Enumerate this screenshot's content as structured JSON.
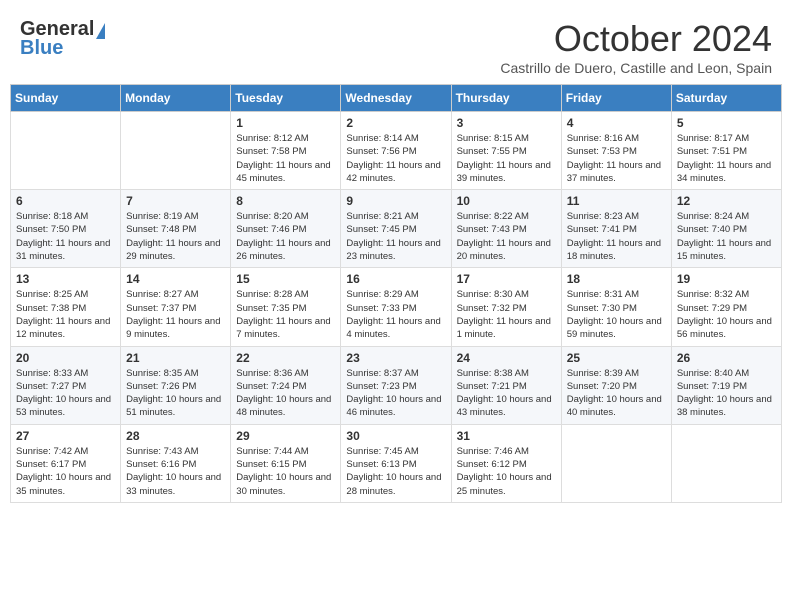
{
  "header": {
    "logo_general": "General",
    "logo_blue": "Blue",
    "month_title": "October 2024",
    "subtitle": "Castrillo de Duero, Castille and Leon, Spain"
  },
  "days_of_week": [
    "Sunday",
    "Monday",
    "Tuesday",
    "Wednesday",
    "Thursday",
    "Friday",
    "Saturday"
  ],
  "weeks": [
    [
      {
        "day": "",
        "content": ""
      },
      {
        "day": "",
        "content": ""
      },
      {
        "day": "1",
        "content": "Sunrise: 8:12 AM\nSunset: 7:58 PM\nDaylight: 11 hours and 45 minutes."
      },
      {
        "day": "2",
        "content": "Sunrise: 8:14 AM\nSunset: 7:56 PM\nDaylight: 11 hours and 42 minutes."
      },
      {
        "day": "3",
        "content": "Sunrise: 8:15 AM\nSunset: 7:55 PM\nDaylight: 11 hours and 39 minutes."
      },
      {
        "day": "4",
        "content": "Sunrise: 8:16 AM\nSunset: 7:53 PM\nDaylight: 11 hours and 37 minutes."
      },
      {
        "day": "5",
        "content": "Sunrise: 8:17 AM\nSunset: 7:51 PM\nDaylight: 11 hours and 34 minutes."
      }
    ],
    [
      {
        "day": "6",
        "content": "Sunrise: 8:18 AM\nSunset: 7:50 PM\nDaylight: 11 hours and 31 minutes."
      },
      {
        "day": "7",
        "content": "Sunrise: 8:19 AM\nSunset: 7:48 PM\nDaylight: 11 hours and 29 minutes."
      },
      {
        "day": "8",
        "content": "Sunrise: 8:20 AM\nSunset: 7:46 PM\nDaylight: 11 hours and 26 minutes."
      },
      {
        "day": "9",
        "content": "Sunrise: 8:21 AM\nSunset: 7:45 PM\nDaylight: 11 hours and 23 minutes."
      },
      {
        "day": "10",
        "content": "Sunrise: 8:22 AM\nSunset: 7:43 PM\nDaylight: 11 hours and 20 minutes."
      },
      {
        "day": "11",
        "content": "Sunrise: 8:23 AM\nSunset: 7:41 PM\nDaylight: 11 hours and 18 minutes."
      },
      {
        "day": "12",
        "content": "Sunrise: 8:24 AM\nSunset: 7:40 PM\nDaylight: 11 hours and 15 minutes."
      }
    ],
    [
      {
        "day": "13",
        "content": "Sunrise: 8:25 AM\nSunset: 7:38 PM\nDaylight: 11 hours and 12 minutes."
      },
      {
        "day": "14",
        "content": "Sunrise: 8:27 AM\nSunset: 7:37 PM\nDaylight: 11 hours and 9 minutes."
      },
      {
        "day": "15",
        "content": "Sunrise: 8:28 AM\nSunset: 7:35 PM\nDaylight: 11 hours and 7 minutes."
      },
      {
        "day": "16",
        "content": "Sunrise: 8:29 AM\nSunset: 7:33 PM\nDaylight: 11 hours and 4 minutes."
      },
      {
        "day": "17",
        "content": "Sunrise: 8:30 AM\nSunset: 7:32 PM\nDaylight: 11 hours and 1 minute."
      },
      {
        "day": "18",
        "content": "Sunrise: 8:31 AM\nSunset: 7:30 PM\nDaylight: 10 hours and 59 minutes."
      },
      {
        "day": "19",
        "content": "Sunrise: 8:32 AM\nSunset: 7:29 PM\nDaylight: 10 hours and 56 minutes."
      }
    ],
    [
      {
        "day": "20",
        "content": "Sunrise: 8:33 AM\nSunset: 7:27 PM\nDaylight: 10 hours and 53 minutes."
      },
      {
        "day": "21",
        "content": "Sunrise: 8:35 AM\nSunset: 7:26 PM\nDaylight: 10 hours and 51 minutes."
      },
      {
        "day": "22",
        "content": "Sunrise: 8:36 AM\nSunset: 7:24 PM\nDaylight: 10 hours and 48 minutes."
      },
      {
        "day": "23",
        "content": "Sunrise: 8:37 AM\nSunset: 7:23 PM\nDaylight: 10 hours and 46 minutes."
      },
      {
        "day": "24",
        "content": "Sunrise: 8:38 AM\nSunset: 7:21 PM\nDaylight: 10 hours and 43 minutes."
      },
      {
        "day": "25",
        "content": "Sunrise: 8:39 AM\nSunset: 7:20 PM\nDaylight: 10 hours and 40 minutes."
      },
      {
        "day": "26",
        "content": "Sunrise: 8:40 AM\nSunset: 7:19 PM\nDaylight: 10 hours and 38 minutes."
      }
    ],
    [
      {
        "day": "27",
        "content": "Sunrise: 7:42 AM\nSunset: 6:17 PM\nDaylight: 10 hours and 35 minutes."
      },
      {
        "day": "28",
        "content": "Sunrise: 7:43 AM\nSunset: 6:16 PM\nDaylight: 10 hours and 33 minutes."
      },
      {
        "day": "29",
        "content": "Sunrise: 7:44 AM\nSunset: 6:15 PM\nDaylight: 10 hours and 30 minutes."
      },
      {
        "day": "30",
        "content": "Sunrise: 7:45 AM\nSunset: 6:13 PM\nDaylight: 10 hours and 28 minutes."
      },
      {
        "day": "31",
        "content": "Sunrise: 7:46 AM\nSunset: 6:12 PM\nDaylight: 10 hours and 25 minutes."
      },
      {
        "day": "",
        "content": ""
      },
      {
        "day": "",
        "content": ""
      }
    ]
  ]
}
